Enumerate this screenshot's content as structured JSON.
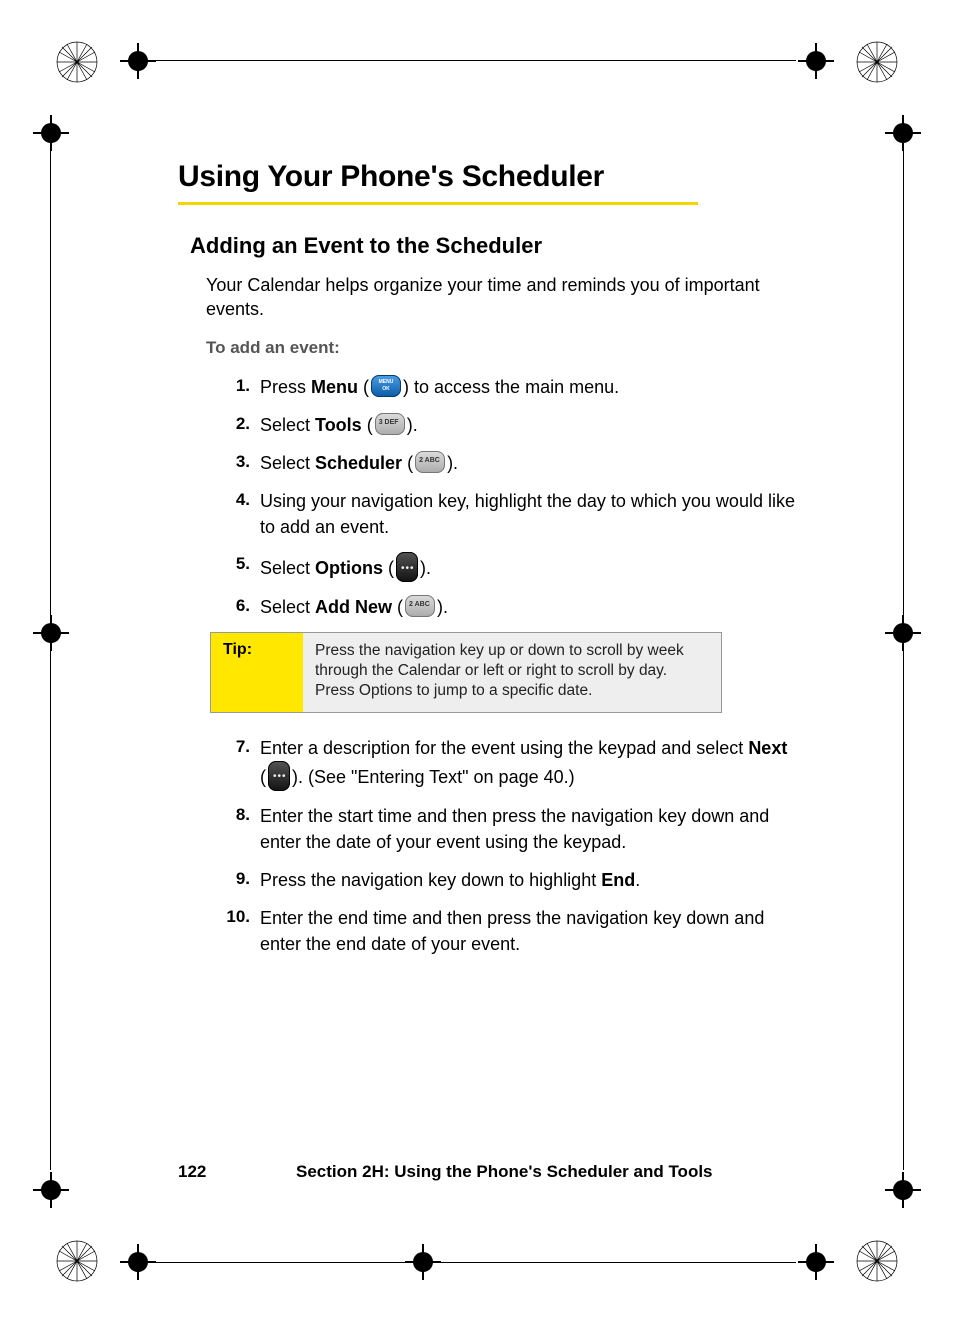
{
  "heading": "Using Your Phone's Scheduler",
  "subheading": "Adding an Event to the Scheduler",
  "intro": "Your Calendar helps organize your time and reminds you of important events.",
  "instruction_label": "To add an event:",
  "steps": {
    "s1_num": "1.",
    "s1_a": "Press ",
    "s1_b": "Menu",
    "s1_c": " (",
    "s1_d": ") to access the main menu.",
    "s2_num": "2.",
    "s2_a": "Select ",
    "s2_b": "Tools",
    "s2_c": " (",
    "s2_d": ").",
    "s3_num": "3.",
    "s3_a": "Select ",
    "s3_b": "Scheduler",
    "s3_c": " (",
    "s3_d": ").",
    "s4_num": "4.",
    "s4_a": "Using your navigation key, highlight the day to which you would like to add an event.",
    "s5_num": "5.",
    "s5_a": "Select ",
    "s5_b": "Options",
    "s5_c": " (",
    "s5_d": ").",
    "s6_num": "6.",
    "s6_a": "Select ",
    "s6_b": "Add New",
    "s6_c": " (",
    "s6_d": ").",
    "s7_num": "7.",
    "s7_a": "Enter a description for the event using the keypad and select ",
    "s7_b": "Next",
    "s7_c": " (",
    "s7_d": "). (See \"Entering Text\" on page 40.)",
    "s8_num": "8.",
    "s8_a": "Enter the start time and then press the navigation key down and enter the date of your event using the keypad.",
    "s9_num": "9.",
    "s9_a": "Press the navigation key down to highlight ",
    "s9_b": "End",
    "s9_c": ".",
    "s10_num": "10.",
    "s10_a": "Enter the end time and then press the navigation key down and enter the end date of your event."
  },
  "tip": {
    "label": "Tip:",
    "text": "Press the navigation key up or down to scroll by week through the Calendar or left or right to scroll by day. Press Options to jump to a specific date."
  },
  "footer": {
    "page": "122",
    "section": "Section 2H: Using the Phone's Scheduler and Tools"
  },
  "icons": {
    "menu_ok": "menu-ok-button",
    "key3": "3 DEF",
    "key2": "2 ABC",
    "softkey": "right-softkey"
  }
}
